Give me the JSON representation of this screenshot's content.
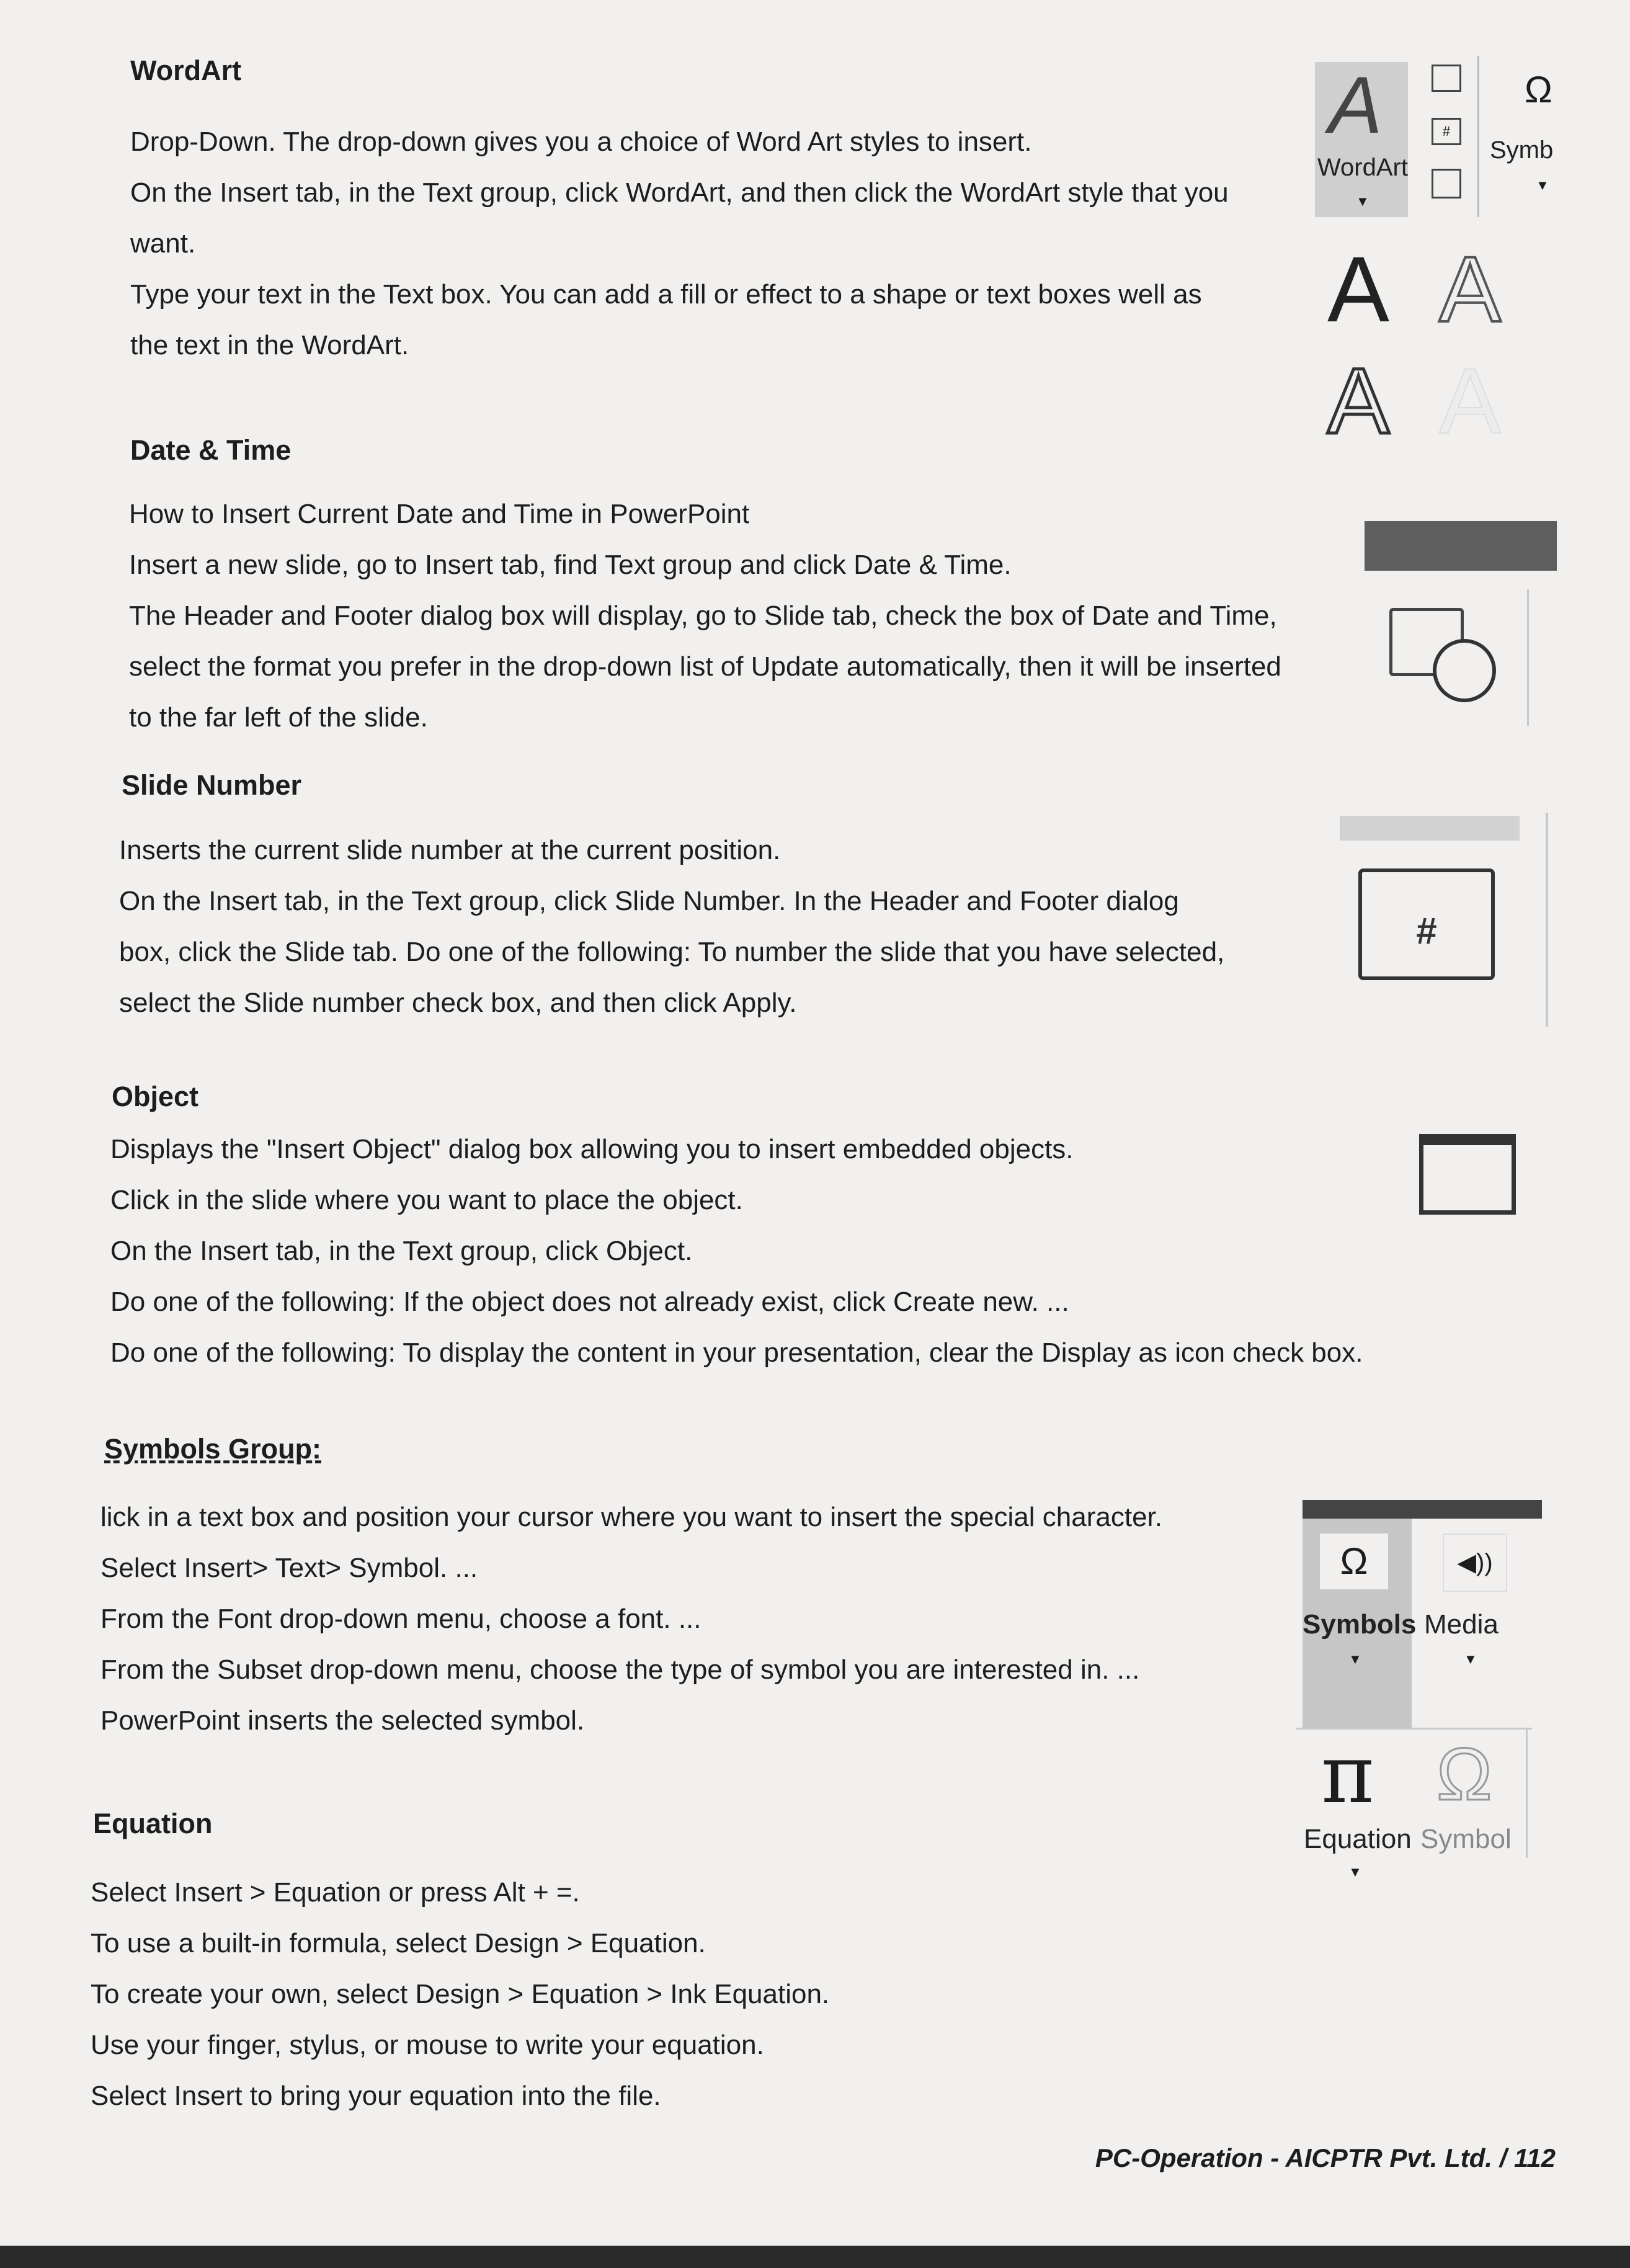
{
  "sections": {
    "wordart": {
      "heading": "WordArt",
      "lines": [
        "Drop-Down. The drop-down gives you a choice of Word Art styles to insert.",
        "On the Insert tab, in the Text group, click WordArt, and then click the WordArt style that you",
        "want.",
        "Type your text in the Text box. You can add a fill or effect to a shape or text boxes well as",
        "the text in the WordArt."
      ],
      "ribbon": {
        "wordart_label": "WordArt",
        "symbol_label": "Symb",
        "omega": "Ω"
      },
      "styles_glyph": "A"
    },
    "datetime": {
      "heading": "Date & Time",
      "lines": [
        "How to Insert Current Date and Time in PowerPoint",
        "Insert a new slide, go to Insert tab, find Text group and click Date & Time.",
        "The Header and Footer dialog box will display, go to Slide tab, check the box of Date and Time,",
        "select the format you prefer in the drop-down list of Update automatically, then it will be inserted",
        "to the far left of the slide."
      ]
    },
    "slidenumber": {
      "heading": "Slide Number",
      "lines": [
        "Inserts the current slide number at the current position.",
        "On the Insert tab, in the Text group, click Slide Number. In the Header and Footer dialog",
        "box, click the Slide tab. Do one of the following: To number the slide that you have selected,",
        "select the Slide number check box, and then click Apply."
      ],
      "icon_glyph": "#"
    },
    "object": {
      "heading": "Object",
      "lines": [
        "Displays the \"Insert Object\" dialog box allowing you to insert embedded objects.",
        "Click in the slide where you want to place the object.",
        "On the Insert tab, in the Text group, click Object.",
        "Do one of the following: If the object does not already exist, click Create new. ...",
        "Do one of the following: To display the content in your presentation, clear the Display as icon check box."
      ]
    },
    "symbols": {
      "heading": "Symbols Group:",
      "lines": [
        "lick in a text box and position your cursor where you want to insert the special character.",
        "Select Insert> Text> Symbol. ...",
        "From the Font drop-down menu, choose a font. ...",
        "From the Subset drop-down menu, choose the type of symbol you are interested in. ...",
        "PowerPoint inserts the selected symbol."
      ],
      "ribbon": {
        "symbols_label": "Symbols",
        "media_label": "Media",
        "omega": "Ω",
        "speaker": "◀))"
      }
    },
    "equation": {
      "heading": "Equation",
      "lines": [
        "Select Insert > Equation or press Alt + =.",
        "To use a built-in formula, select Design > Equation.",
        "To create your own, select Design > Equation > Ink Equation.",
        "Use your finger, stylus, or mouse to write your equation.",
        "Select Insert to bring your equation into the file."
      ],
      "ribbon": {
        "equation_label": "Equation",
        "symbol_label": "Symbol",
        "pi": "π",
        "omega": "Ω"
      }
    }
  },
  "footer": "PC-Operation - AICPTR Pvt. Ltd.  / 112",
  "colors": {
    "ribbon_gray": "#c9c9c9",
    "dark_strip": "#5e5e5e",
    "text": "#1d1d1d"
  }
}
